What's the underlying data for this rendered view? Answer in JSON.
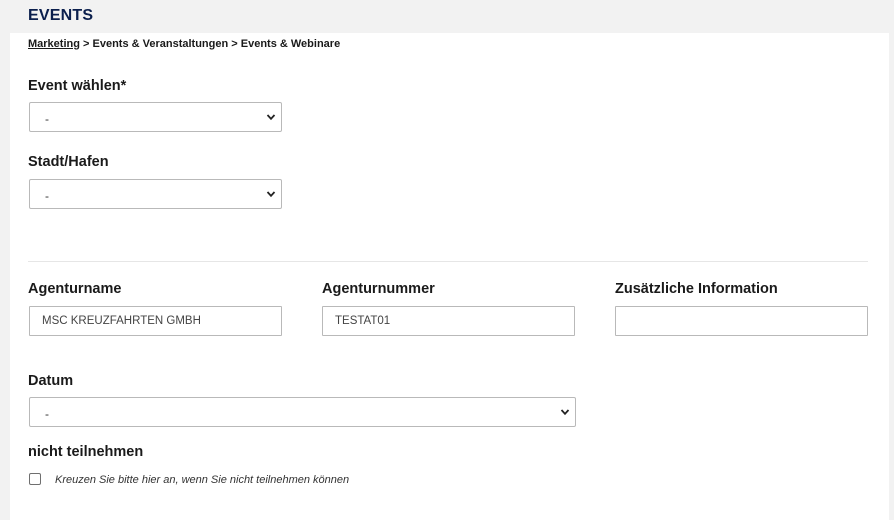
{
  "page": {
    "title": "EVENTS"
  },
  "breadcrumb": {
    "link": "Marketing",
    "rest": " > Events & Veranstaltungen > Events & Webinare"
  },
  "event": {
    "label": "Event wählen*",
    "value": "-"
  },
  "city": {
    "label": "Stadt/Hafen",
    "value": "-"
  },
  "agency_name": {
    "label": "Agenturname",
    "value": "MSC KREUZFAHRTEN GMBH"
  },
  "agency_number": {
    "label": "Agenturnummer",
    "value": "TESTAT01"
  },
  "additional_info": {
    "label": "Zusätzliche Information",
    "value": ""
  },
  "date": {
    "label": "Datum",
    "value": "-"
  },
  "not_attending": {
    "label": "nicht teilnehmen",
    "checkbox_text": "Kreuzen Sie bitte hier an, wenn Sie nicht teilnehmen können",
    "checked": false
  },
  "icons": {
    "select_arrow": "chevron-down-icon"
  }
}
